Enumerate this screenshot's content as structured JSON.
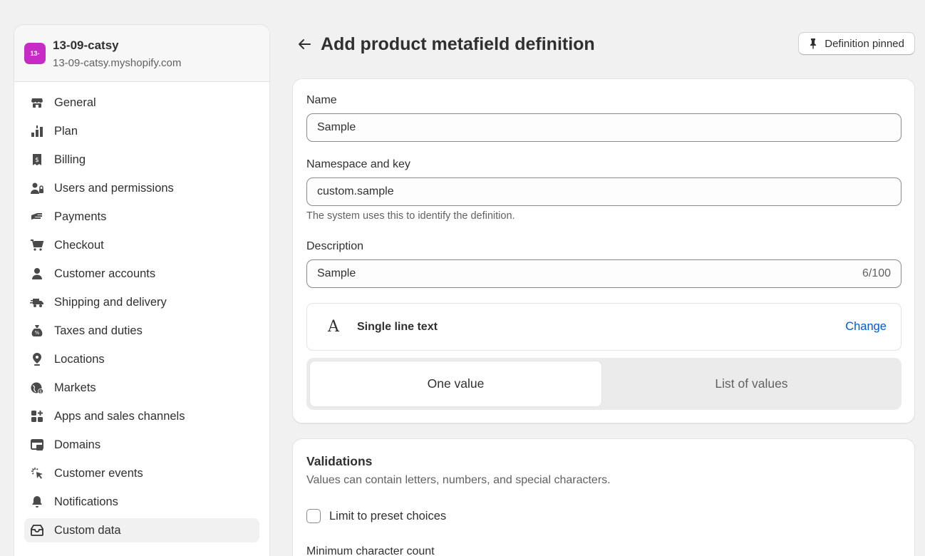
{
  "store": {
    "badge": "13-",
    "name": "13-09-catsy",
    "domain": "13-09-catsy.myshopify.com",
    "badge_color": "#c62bc6"
  },
  "sidebar": {
    "items": [
      {
        "label": "General",
        "icon": "store-icon"
      },
      {
        "label": "Plan",
        "icon": "plan-icon"
      },
      {
        "label": "Billing",
        "icon": "billing-icon"
      },
      {
        "label": "Users and permissions",
        "icon": "users-icon"
      },
      {
        "label": "Payments",
        "icon": "payments-icon"
      },
      {
        "label": "Checkout",
        "icon": "cart-icon"
      },
      {
        "label": "Customer accounts",
        "icon": "person-icon"
      },
      {
        "label": "Shipping and delivery",
        "icon": "truck-icon"
      },
      {
        "label": "Taxes and duties",
        "icon": "tax-bag-icon"
      },
      {
        "label": "Locations",
        "icon": "location-pin-icon"
      },
      {
        "label": "Markets",
        "icon": "globe-icon"
      },
      {
        "label": "Apps and sales channels",
        "icon": "apps-icon"
      },
      {
        "label": "Domains",
        "icon": "domains-icon"
      },
      {
        "label": "Customer events",
        "icon": "cursor-click-icon"
      },
      {
        "label": "Notifications",
        "icon": "bell-icon"
      },
      {
        "label": "Custom data",
        "icon": "custom-data-icon",
        "active": true
      }
    ]
  },
  "header": {
    "title": "Add product metafield definition",
    "pin_button": "Definition pinned"
  },
  "form": {
    "name_label": "Name",
    "name_value": "Sample",
    "namespace_label": "Namespace and key",
    "namespace_value": "custom.sample",
    "namespace_help": "The system uses this to identify the definition.",
    "description_label": "Description",
    "description_value": "Sample",
    "description_counter": "6/100",
    "type_icon": "A",
    "type_label": "Single line text",
    "change_link": "Change",
    "segment_one": "One value",
    "segment_list": "List of values"
  },
  "validations": {
    "title": "Validations",
    "subtitle": "Values can contain letters, numbers, and special characters.",
    "checkbox_label": "Limit to preset choices",
    "min_label": "Minimum character count"
  },
  "colors": {
    "accent_link": "#005bd3",
    "background": "#f1f1f1"
  }
}
